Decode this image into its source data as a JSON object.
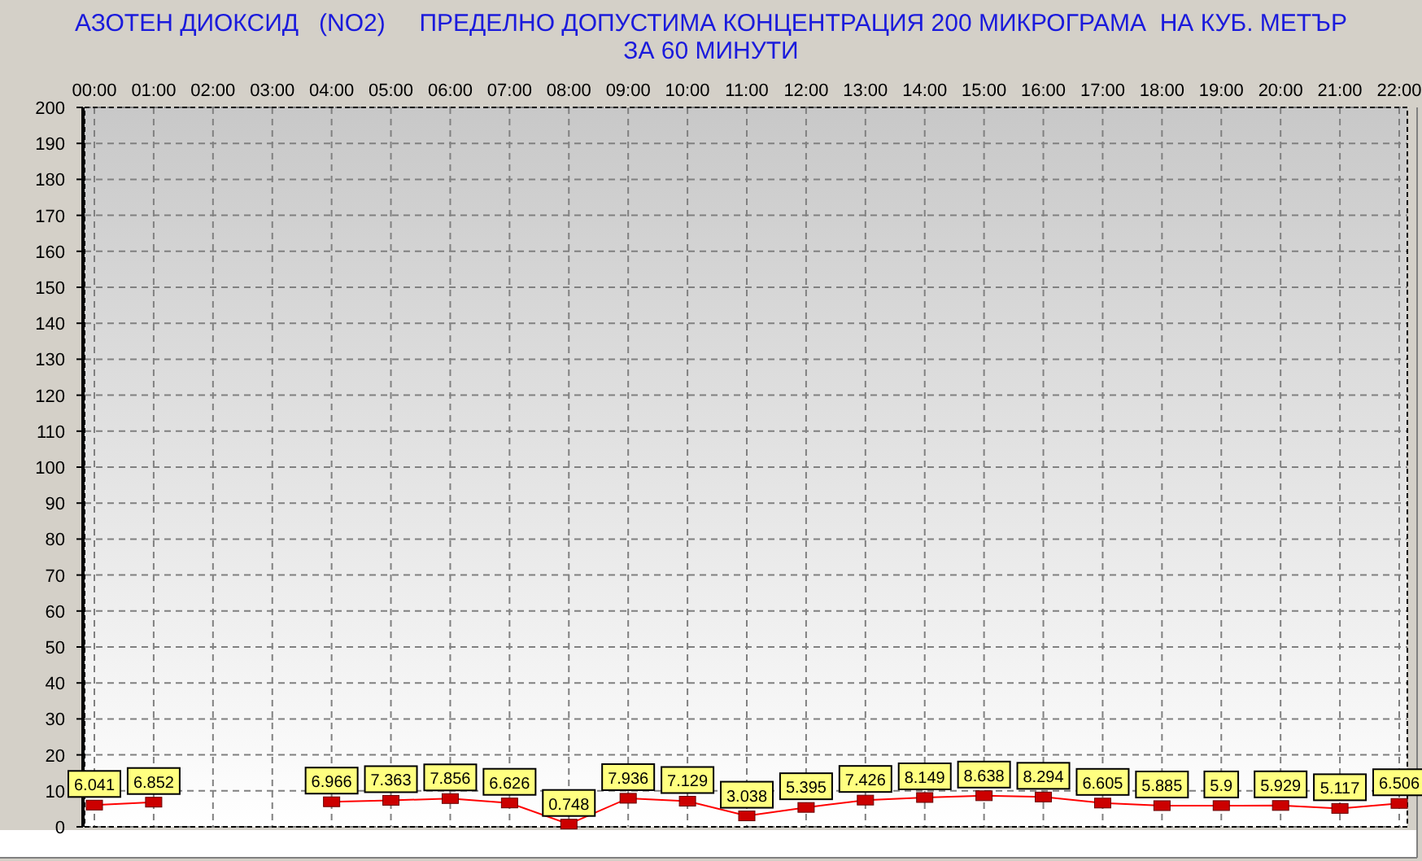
{
  "title_lines": [
    "АЗОТЕН ДИОКСИД   (NO2)     ПРЕДЕЛНО ДОПУСТИМА КОНЦЕНТРАЦИЯ 200 МИКРОГРАМА  НА КУБ. МЕТЪР",
    "ЗА 60 МИНУТИ"
  ],
  "chart": {
    "chart_data": {
      "type": "line",
      "categories": [
        "00:00",
        "01:00",
        "02:00",
        "03:00",
        "04:00",
        "05:00",
        "06:00",
        "07:00",
        "08:00",
        "09:00",
        "10:00",
        "11:00",
        "12:00",
        "13:00",
        "14:00",
        "15:00",
        "16:00",
        "17:00",
        "18:00",
        "19:00",
        "20:00",
        "21:00",
        "22:00"
      ],
      "series": [
        {
          "color": "#ff0000",
          "marker": "square",
          "values": [
            6.041,
            6.852,
            null,
            null,
            6.966,
            7.363,
            7.856,
            6.626,
            0.748,
            7.936,
            7.129,
            3.038,
            5.395,
            7.426,
            8.149,
            8.638,
            8.294,
            6.605,
            5.885,
            5.9,
            5.929,
            5.117,
            6.506
          ]
        }
      ],
      "data_labels": true,
      "grid": true,
      "ylim": [
        0,
        200
      ],
      "yticks": [
        0,
        10,
        20,
        30,
        40,
        50,
        60,
        70,
        80,
        90,
        100,
        110,
        120,
        130,
        140,
        150,
        160,
        170,
        180,
        190,
        200
      ]
    }
  }
}
